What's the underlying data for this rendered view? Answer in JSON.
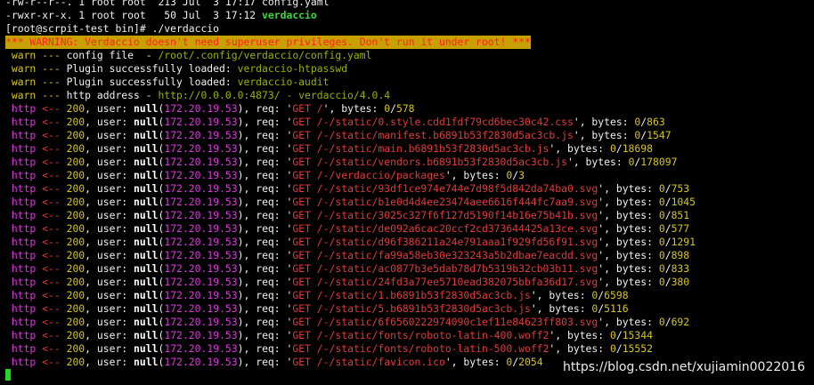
{
  "top_lines": [
    "-rw-r--r--. 1 root root  213 Jul  3 17:17 config.yaml"
  ],
  "ls_entry": {
    "text": "-rwxr-xr-x. 1 root root   50 Jul  3 17:12 ",
    "name": "verdaccio"
  },
  "prompt_line": "[root@scrpit-test bin]# ./verdaccio",
  "warning_banner": "*** WARNING: Verdaccio doesn't need superuser privileges. Don't run it under root! ***",
  "warn_lines": [
    {
      "prefix": " warn --- ",
      "text": "config file  - ",
      "value": "/root/.config/verdaccio/config.yaml",
      "suffix": ""
    },
    {
      "prefix": " warn --- ",
      "text": "Plugin successfully loaded: ",
      "value": "verdaccio-htpasswd",
      "suffix": ""
    },
    {
      "prefix": " warn --- ",
      "text": "Plugin successfully loaded: ",
      "value": "verdaccio-audit",
      "suffix": ""
    },
    {
      "prefix": " warn --- ",
      "text": "http address - ",
      "value": "http://0.0.0.0:4873/",
      "suffix": " - verdaccio/4.0.4"
    }
  ],
  "http_log": {
    "ip": "172.20.19.53",
    "entries": [
      {
        "req": "GET /",
        "bytes": "0/578"
      },
      {
        "req": "GET /-/static/0.style.cdd1fdf79cd6bec30c42.css",
        "bytes": "0/863"
      },
      {
        "req": "GET /-/static/manifest.b6891b53f2830d5ac3cb.js",
        "bytes": "0/1547"
      },
      {
        "req": "GET /-/static/main.b6891b53f2830d5ac3cb.js",
        "bytes": "0/18698"
      },
      {
        "req": "GET /-/static/vendors.b6891b53f2830d5ac3cb.js",
        "bytes": "0/178097"
      },
      {
        "req": "GET /-/verdaccio/packages",
        "bytes": "0/3"
      },
      {
        "req": "GET /-/static/93df1ce974e744e7d98f5d842da74ba0.svg",
        "bytes": "0/753"
      },
      {
        "req": "GET /-/static/b1e0d4d4ee23474aee6616f444fc7aa9.svg",
        "bytes": "0/1045"
      },
      {
        "req": "GET /-/static/3025c327f6f127d5190f14b16e75b41b.svg",
        "bytes": "0/851"
      },
      {
        "req": "GET /-/static/de092a6cac20ccf2cd373644425a13ce.svg",
        "bytes": "0/577"
      },
      {
        "req": "GET /-/static/d96f386211a24e791aaa1f929fd56f91.svg",
        "bytes": "0/1291"
      },
      {
        "req": "GET /-/static/fa99a58eb30e323243a5b2dbae7eacdd.svg",
        "bytes": "0/898"
      },
      {
        "req": "GET /-/static/ac0877b3e5dab78d7b5319b32cb03b11.svg",
        "bytes": "0/833"
      },
      {
        "req": "GET /-/static/24fd3a77ee5710ead382075bbfa36d17.svg",
        "bytes": "0/380"
      },
      {
        "req": "GET /-/static/1.b6891b53f2830d5ac3cb.js",
        "bytes": "0/6598"
      },
      {
        "req": "GET /-/static/5.b6891b53f2830d5ac3cb.js",
        "bytes": "0/5116"
      },
      {
        "req": "GET /-/static/6f6560222974090c1ef11e84623ff803.svg",
        "bytes": "0/692"
      },
      {
        "req": "GET /-/static/fonts/roboto-latin-400.woff2",
        "bytes": "0/15344"
      },
      {
        "req": "GET /-/static/fonts/roboto-latin-500.woff2",
        "bytes": "0/15552"
      },
      {
        "req": "GET /-/static/favicon.ico",
        "bytes": "0/2054"
      }
    ]
  },
  "watermark": "https://blog.csdn.net/xujiamin0022016"
}
